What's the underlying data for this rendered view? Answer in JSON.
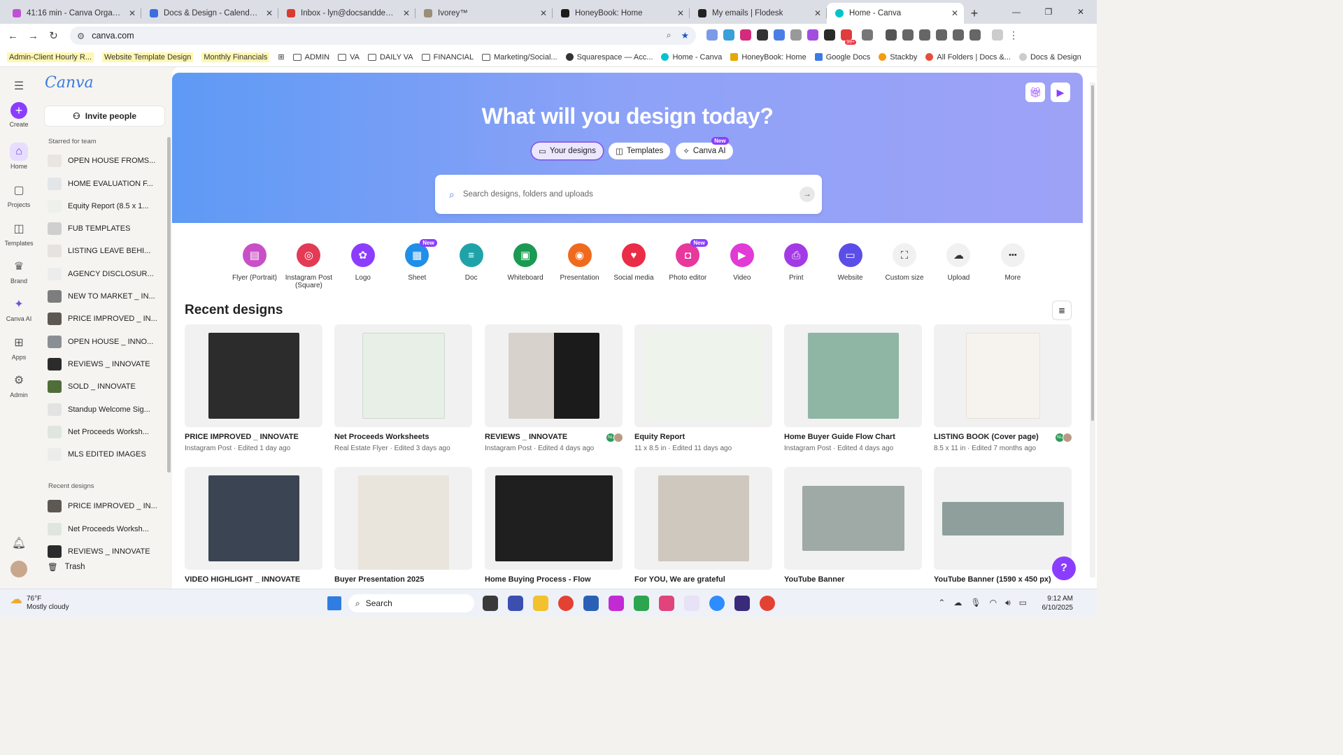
{
  "browser": {
    "tabs": [
      {
        "title": "41:16 min - Canva Organization",
        "color": "#c04fd6"
      },
      {
        "title": "Docs & Design - Calendar - We",
        "color": "#3b6ee0"
      },
      {
        "title": "Inbox - lyn@docsanddesign.co",
        "color": "#d93b2e"
      },
      {
        "title": "Ivorey™",
        "color": "#9a8f76"
      },
      {
        "title": "HoneyBook: Home",
        "color": "#1b1b1b"
      },
      {
        "title": "My emails | Flodesk",
        "color": "#222222"
      },
      {
        "title": "Home - Canva",
        "color": "#00c4cc"
      }
    ],
    "url": "canva.com",
    "bookmarks": [
      {
        "label": "Admin-Client Hourly R...",
        "highlight": true
      },
      {
        "label": "Website Template Design",
        "highlight": true
      },
      {
        "label": "Monthly Financials",
        "highlight": true
      },
      {
        "label": "ADMIN"
      },
      {
        "label": "VA"
      },
      {
        "label": "DAILY VA"
      },
      {
        "label": "FINANCIAL"
      },
      {
        "label": "Marketing/Social..."
      },
      {
        "label": "Squarespace — Acc..."
      },
      {
        "label": "Home - Canva"
      },
      {
        "label": "HoneyBook: Home"
      },
      {
        "label": "Google Docs"
      },
      {
        "label": "Stackby"
      },
      {
        "label": "All Folders | Docs &..."
      },
      {
        "label": "Docs & Design"
      }
    ],
    "extension_badge": "99+"
  },
  "rail": [
    {
      "label": "Create",
      "icon": "+"
    },
    {
      "label": "Home",
      "icon": "⌂"
    },
    {
      "label": "Projects",
      "icon": "▢"
    },
    {
      "label": "Templates",
      "icon": "◫"
    },
    {
      "label": "Brand",
      "icon": "♛"
    },
    {
      "label": "Canva AI",
      "icon": "✦"
    },
    {
      "label": "Apps",
      "icon": "⊞"
    },
    {
      "label": "Admin",
      "icon": "⚙"
    }
  ],
  "sidebar": {
    "logo": "Canva",
    "invite": "Invite people",
    "starred_heading": "Starred for team",
    "starred": [
      "OPEN HOUSE FROMS...",
      "HOME EVALUATION F...",
      "Equity Report (8.5 x 1...",
      "FUB TEMPLATES",
      "LISTING LEAVE BEHI...",
      "AGENCY DISCLOSUR...",
      "NEW TO MARKET _ IN...",
      "PRICE IMPROVED _ IN...",
      "OPEN HOUSE _ INNO...",
      "REVIEWS _ INNOVATE",
      "SOLD _ INNOVATE",
      "Standup Welcome Sig...",
      "Net Proceeds Worksh...",
      "MLS EDITED IMAGES"
    ],
    "recent_heading": "Recent designs",
    "recent": [
      "PRICE IMPROVED _ IN...",
      "Net Proceeds Worksh...",
      "REVIEWS _ INNOVATE"
    ],
    "trash": "Trash"
  },
  "hero": {
    "title": "What will you design today?",
    "pills": [
      "Your designs",
      "Templates",
      "Canva AI"
    ],
    "new_badge": "New",
    "search_placeholder": "Search designs, folders and uploads"
  },
  "design_types": [
    {
      "label": "Flyer (Portrait)",
      "color": "#c94fc7",
      "icon": "▤"
    },
    {
      "label": "Instagram Post (Square)",
      "color": "#e33a55",
      "icon": "◎"
    },
    {
      "label": "Logo",
      "color": "#8b3dff",
      "icon": "✿"
    },
    {
      "label": "Sheet",
      "color": "#1f8fe8",
      "icon": "▦",
      "new": true
    },
    {
      "label": "Doc",
      "color": "#1fa3a8",
      "icon": "≡"
    },
    {
      "label": "Whiteboard",
      "color": "#1a9a52",
      "icon": "▣"
    },
    {
      "label": "Presentation",
      "color": "#f06a1e",
      "icon": "◉"
    },
    {
      "label": "Social media",
      "color": "#ea2c46",
      "icon": "♥"
    },
    {
      "label": "Photo editor",
      "color": "#e8389c",
      "icon": "◘",
      "new": true
    },
    {
      "label": "Video",
      "color": "#e23ad6",
      "icon": "▶"
    },
    {
      "label": "Print",
      "color": "#a43ae6",
      "icon": "⎙"
    },
    {
      "label": "Website",
      "color": "#5b4ee8",
      "icon": "▭"
    },
    {
      "label": "Custom size",
      "color": "#ffffff",
      "icon": "⛶"
    },
    {
      "label": "Upload",
      "color": "#ffffff",
      "icon": "☁"
    },
    {
      "label": "More",
      "color": "#ffffff",
      "icon": "•••"
    }
  ],
  "recent_title": "Recent designs",
  "designs": [
    {
      "name": "PRICE IMPROVED _ INNOVATE",
      "meta": "Instagram Post · Edited 1 day ago",
      "color": "#2c2c2c"
    },
    {
      "name": "Net Proceeds Worksheets",
      "meta": "Real Estate Flyer · Edited 3 days ago",
      "color": "#e8efe7"
    },
    {
      "name": "REVIEWS _ INNOVATE",
      "meta": "Instagram Post · Edited 4 days ago",
      "color": "#d7d2cc",
      "avatars": "NL"
    },
    {
      "name": "Equity Report",
      "meta": "11 x 8.5 in · Edited 11 days ago",
      "color": "#eef4ec"
    },
    {
      "name": "Home Buyer Guide Flow Chart",
      "meta": "Instagram Post · Edited 4 days ago",
      "color": "#8fb5a4"
    },
    {
      "name": "LISTING BOOK (Cover page)",
      "meta": "8.5 x 11 in · Edited 7 months ago",
      "color": "#f6f3ee",
      "avatars": "NL"
    },
    {
      "name": "VIDEO HIGHLIGHT _ INNOVATE",
      "meta": "",
      "color": "#3a4452"
    },
    {
      "name": "Buyer Presentation 2025",
      "meta": "",
      "color": "#e9e4dc"
    },
    {
      "name": "Home Buying Process - Flow",
      "meta": "",
      "color": "#1f1f1f"
    },
    {
      "name": "For YOU, We are grateful",
      "meta": "",
      "color": "#cfc8bf"
    },
    {
      "name": "YouTube Banner",
      "meta": "",
      "color": "#9fa9a6"
    },
    {
      "name": "YouTube Banner (1590 x 450 px)",
      "meta": "",
      "color": "#8e9f9c"
    }
  ],
  "taskbar": {
    "temp": "76°F",
    "weather": "Mostly cloudy",
    "search": "Search",
    "time": "9:12 AM",
    "date": "6/10/2025"
  }
}
